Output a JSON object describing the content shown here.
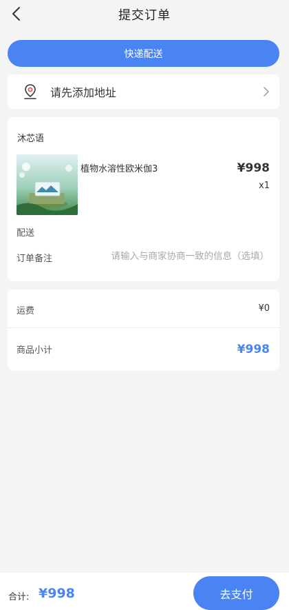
{
  "header": {
    "title": "提交订单"
  },
  "delivery": {
    "label": "快递配送"
  },
  "address": {
    "label": "请先添加地址"
  },
  "order": {
    "shop_name": "沐芯语",
    "product": {
      "name": "植物水溶性欧米伽3",
      "price": "¥998",
      "qty": "x1"
    },
    "shipping_label": "配送",
    "remark": {
      "label": "订单备注",
      "placeholder": "请输入与商家协商一致的信息（选填）",
      "value": ""
    }
  },
  "fees": {
    "freight": {
      "label": "运费",
      "value": "¥0"
    },
    "subtotal": {
      "label": "商品小计",
      "value": "¥998"
    }
  },
  "footer": {
    "total_label": "合计:",
    "total_value": "¥998",
    "pay_label": "去支付"
  },
  "colors": {
    "accent": "#4a84f3",
    "background": "#f4f4f5"
  }
}
